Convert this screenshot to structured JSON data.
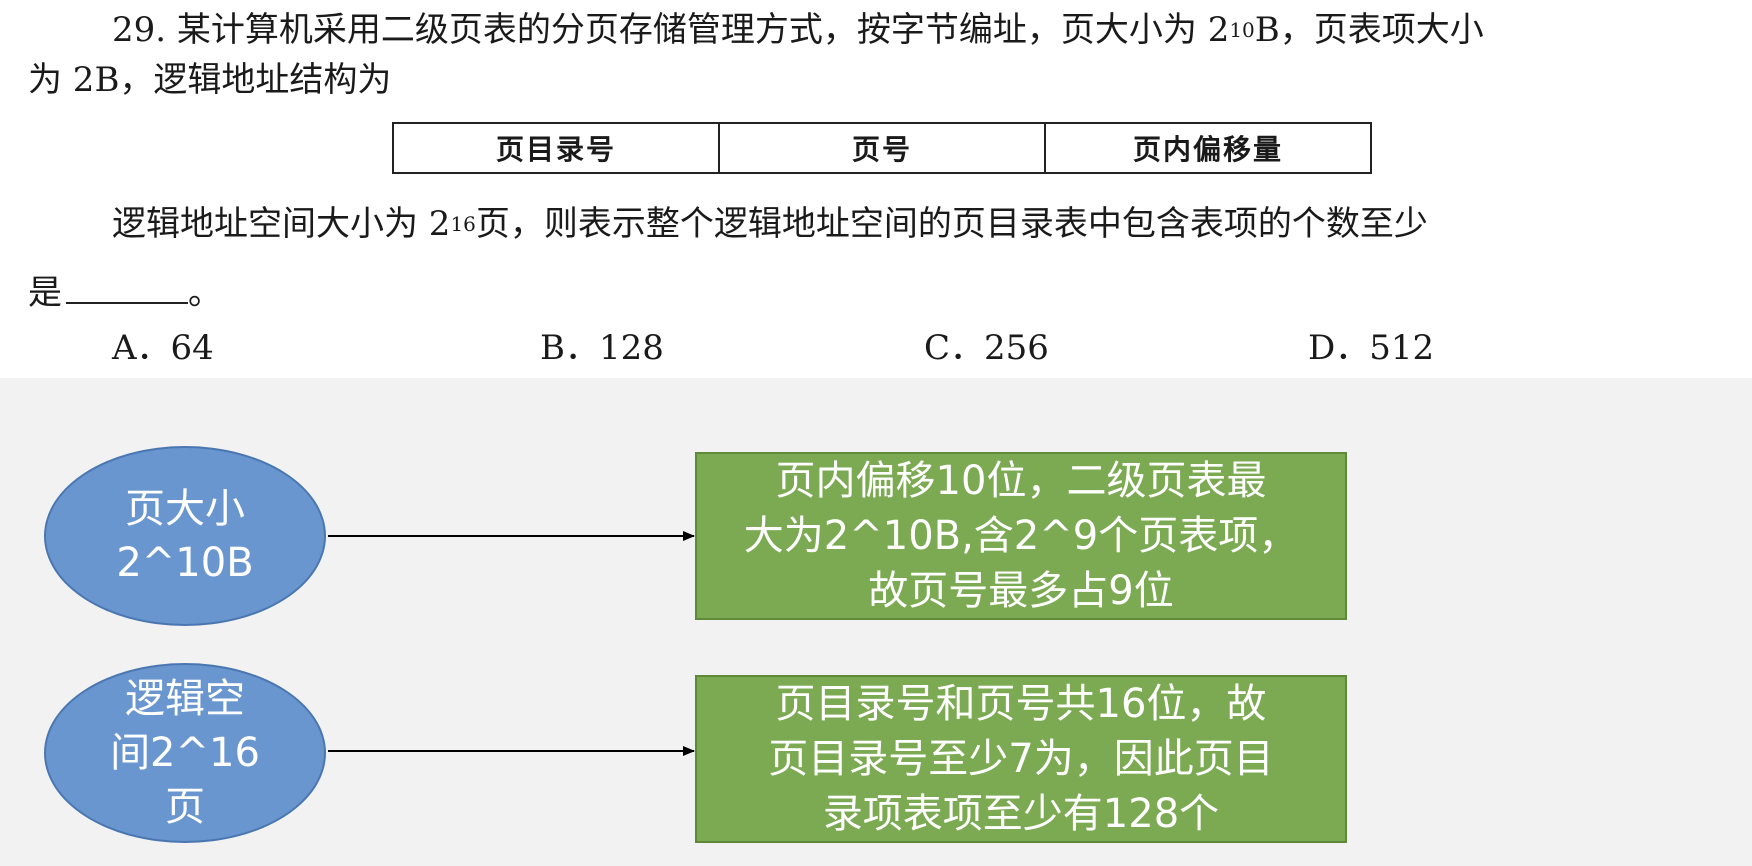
{
  "question": {
    "number": "29.",
    "line1_a": "某计算机采用二级页表的分页存储管理方式，按字节编址，页大小为 2",
    "line1_sup": "10",
    "line1_b": "B，页表项大小",
    "line2": "为 2B，逻辑地址结构为",
    "table": [
      "页目录号",
      "页号",
      "页内偏移量"
    ],
    "line3_a": "逻辑地址空间大小为 2",
    "line3_sup": "16",
    "line3_b": "页，则表示整个逻辑地址空间的页目录表中包含表项的个数至少",
    "line4_a": "是",
    "line4_b": "。",
    "options": [
      "A．64",
      "B．128",
      "C．256",
      "D．512"
    ]
  },
  "diagram": {
    "nodes": [
      {
        "shape": "ellipse",
        "text": "页大小\n2^10B"
      },
      {
        "shape": "ellipse",
        "text": "逻辑空\n间2^16\n页"
      },
      {
        "shape": "box",
        "text": "页内偏移10位，二级页表最\n大为2^10B,含2^9个页表项，\n故页号最多占9位"
      },
      {
        "shape": "box",
        "text": "页目录号和页号共16位，故\n页目录号至少7为，因此页目\n录项表项至少有128个"
      }
    ],
    "colors": {
      "ellipse_fill": "#6a96cf",
      "box_fill": "#7caa53",
      "background": "#f2f2f2",
      "arrow": "#000000"
    }
  }
}
